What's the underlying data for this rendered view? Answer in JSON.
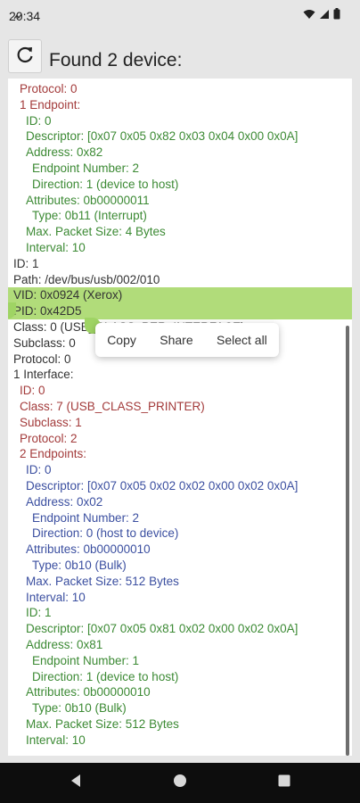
{
  "status_bar": {
    "time": "20:34",
    "icons": [
      "signal-wave-icon",
      "wifi-icon",
      "cellular-icon",
      "battery-icon"
    ]
  },
  "header": {
    "refresh_icon": "refresh-icon",
    "title": "Found 2 device:"
  },
  "device_lines": [
    {
      "text": "Protocol: 0",
      "level": 1,
      "color": "red"
    },
    {
      "text": "1 Endpoint:",
      "level": 1,
      "color": "red"
    },
    {
      "text": "ID: 0",
      "level": 2,
      "color": "green"
    },
    {
      "text": "Descriptor: [0x07 0x05 0x82 0x03 0x04 0x00 0x0A]",
      "level": 2,
      "color": "green"
    },
    {
      "text": "Address: 0x82",
      "level": 2,
      "color": "green"
    },
    {
      "text": "Endpoint Number: 2",
      "level": 3,
      "color": "green"
    },
    {
      "text": "Direction: 1 (device to host)",
      "level": 3,
      "color": "green"
    },
    {
      "text": "Attributes: 0b00000011",
      "level": 2,
      "color": "green"
    },
    {
      "text": "Type: 0b11 (Interrupt)",
      "level": 3,
      "color": "green"
    },
    {
      "text": "Max. Packet Size: 4 Bytes",
      "level": 2,
      "color": "green"
    },
    {
      "text": "Interval: 10",
      "level": 2,
      "color": "green"
    },
    {
      "text": "ID: 1",
      "level": 0,
      "color": "black"
    },
    {
      "text": "Path: /dev/bus/usb/002/010",
      "level": 0,
      "color": "black"
    },
    {
      "text": "VID: 0x0924 (Xerox)",
      "level": 0,
      "color": "black",
      "highlight": true
    },
    {
      "text": "PID: 0x42D5",
      "level": 0,
      "color": "black",
      "highlight": true
    },
    {
      "text": "Class: 0 (USB_CLASS_PER_INTERFACE)",
      "level": 0,
      "color": "black"
    },
    {
      "text": "Subclass: 0",
      "level": 0,
      "color": "black"
    },
    {
      "text": "Protocol: 0",
      "level": 0,
      "color": "black"
    },
    {
      "text": "1 Interface:",
      "level": 0,
      "color": "black"
    },
    {
      "text": "ID: 0",
      "level": 1,
      "color": "red"
    },
    {
      "text": "Class: 7 (USB_CLASS_PRINTER)",
      "level": 1,
      "color": "red"
    },
    {
      "text": "Subclass: 1",
      "level": 1,
      "color": "red"
    },
    {
      "text": "Protocol: 2",
      "level": 1,
      "color": "red"
    },
    {
      "text": "2 Endpoints:",
      "level": 1,
      "color": "red"
    },
    {
      "text": "ID: 0",
      "level": 2,
      "color": "blue"
    },
    {
      "text": "Descriptor: [0x07 0x05 0x02 0x02 0x00 0x02 0x0A]",
      "level": 2,
      "color": "blue"
    },
    {
      "text": "Address: 0x02",
      "level": 2,
      "color": "blue"
    },
    {
      "text": "Endpoint Number: 2",
      "level": 3,
      "color": "blue"
    },
    {
      "text": "Direction: 0 (host to device)",
      "level": 3,
      "color": "blue"
    },
    {
      "text": "Attributes: 0b00000010",
      "level": 2,
      "color": "blue"
    },
    {
      "text": "Type: 0b10 (Bulk)",
      "level": 3,
      "color": "blue"
    },
    {
      "text": "Max. Packet Size: 512 Bytes",
      "level": 2,
      "color": "blue"
    },
    {
      "text": "Interval: 10",
      "level": 2,
      "color": "blue"
    },
    {
      "text": "ID: 1",
      "level": 2,
      "color": "green"
    },
    {
      "text": "Descriptor: [0x07 0x05 0x81 0x02 0x00 0x02 0x0A]",
      "level": 2,
      "color": "green"
    },
    {
      "text": "Address: 0x81",
      "level": 2,
      "color": "green"
    },
    {
      "text": "Endpoint Number: 1",
      "level": 3,
      "color": "green"
    },
    {
      "text": "Direction: 1 (device to host)",
      "level": 3,
      "color": "green"
    },
    {
      "text": "Attributes: 0b00000010",
      "level": 2,
      "color": "green"
    },
    {
      "text": "Type: 0b10 (Bulk)",
      "level": 3,
      "color": "green"
    },
    {
      "text": "Max. Packet Size: 512 Bytes",
      "level": 2,
      "color": "green"
    },
    {
      "text": "Interval: 10",
      "level": 2,
      "color": "green"
    }
  ],
  "context_menu": {
    "copy": "Copy",
    "share": "Share",
    "select_all": "Select all"
  },
  "nav_bar": {
    "back_icon": "back-triangle-icon",
    "home_icon": "home-circle-icon",
    "recents_icon": "recents-square-icon"
  },
  "colors": {
    "red": "#a33b3b",
    "green": "#3c8a34",
    "blue": "#3b4fa0",
    "black": "#333333",
    "selection": "#b1dc7a"
  }
}
